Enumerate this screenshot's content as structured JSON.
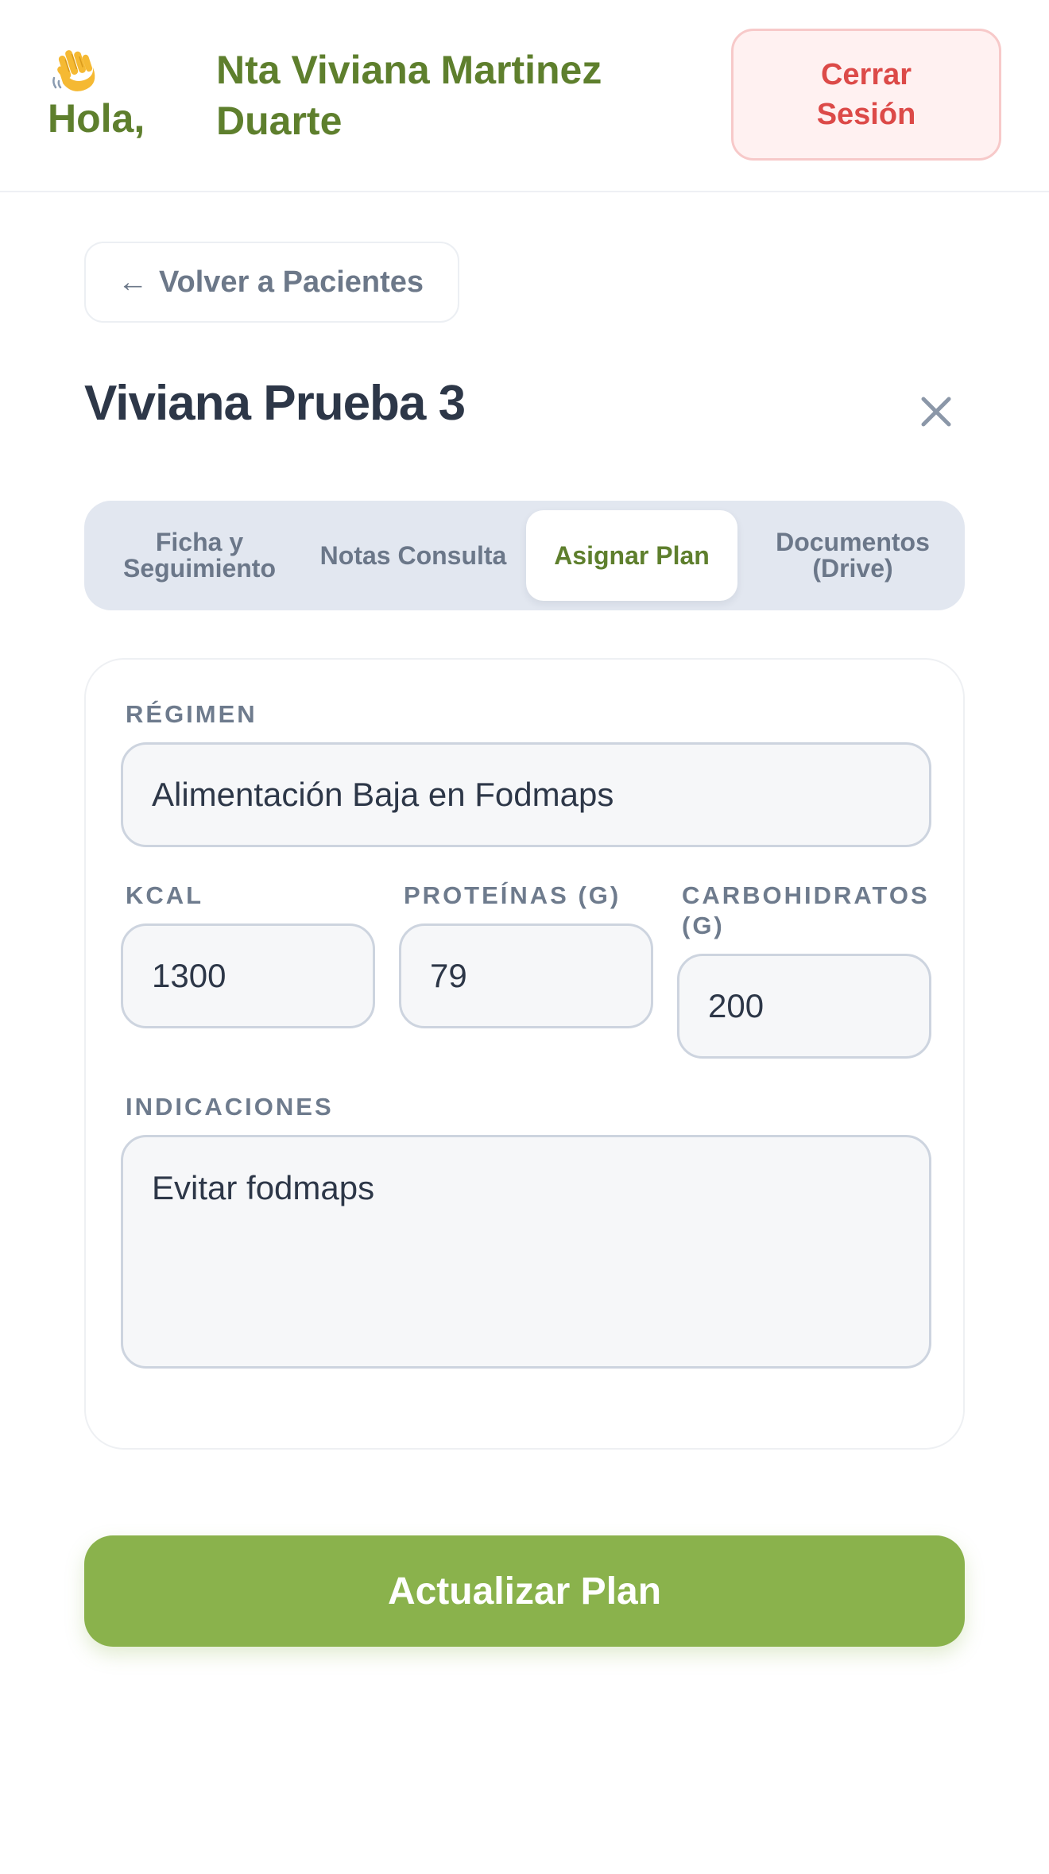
{
  "header": {
    "greeting": "Hola,",
    "user_name": "Nta Viviana Martinez Duarte",
    "logout_label": "Cerrar Sesión",
    "wave_icon": "waving-hand-icon"
  },
  "back_button": {
    "arrow": "←",
    "label": "Volver a Pacientes"
  },
  "patient": {
    "name": "Viviana Prueba 3"
  },
  "tabs": [
    {
      "label": "Ficha y Seguimiento",
      "active": false
    },
    {
      "label": "Notas Consulta",
      "active": false
    },
    {
      "label": "Asignar Plan",
      "active": true
    },
    {
      "label": "Documentos (Drive)",
      "active": false
    }
  ],
  "form": {
    "regimen": {
      "label": "RÉGIMEN",
      "value": "Alimentación Baja en Fodmaps"
    },
    "kcal": {
      "label": "KCAL",
      "value": "1300"
    },
    "proteinas": {
      "label": "PROTEÍNAS (G)",
      "value": "79"
    },
    "carbohidratos": {
      "label": "CARBOHIDRATOS (G)",
      "value": "200"
    },
    "indicaciones": {
      "label": "INDICACIONES",
      "value": "Evitar fodmaps"
    }
  },
  "submit_label": "Actualizar Plan",
  "colors": {
    "brand_green": "#5e7f2d",
    "button_green": "#8ab24c",
    "logout_red": "#dc4a48"
  }
}
